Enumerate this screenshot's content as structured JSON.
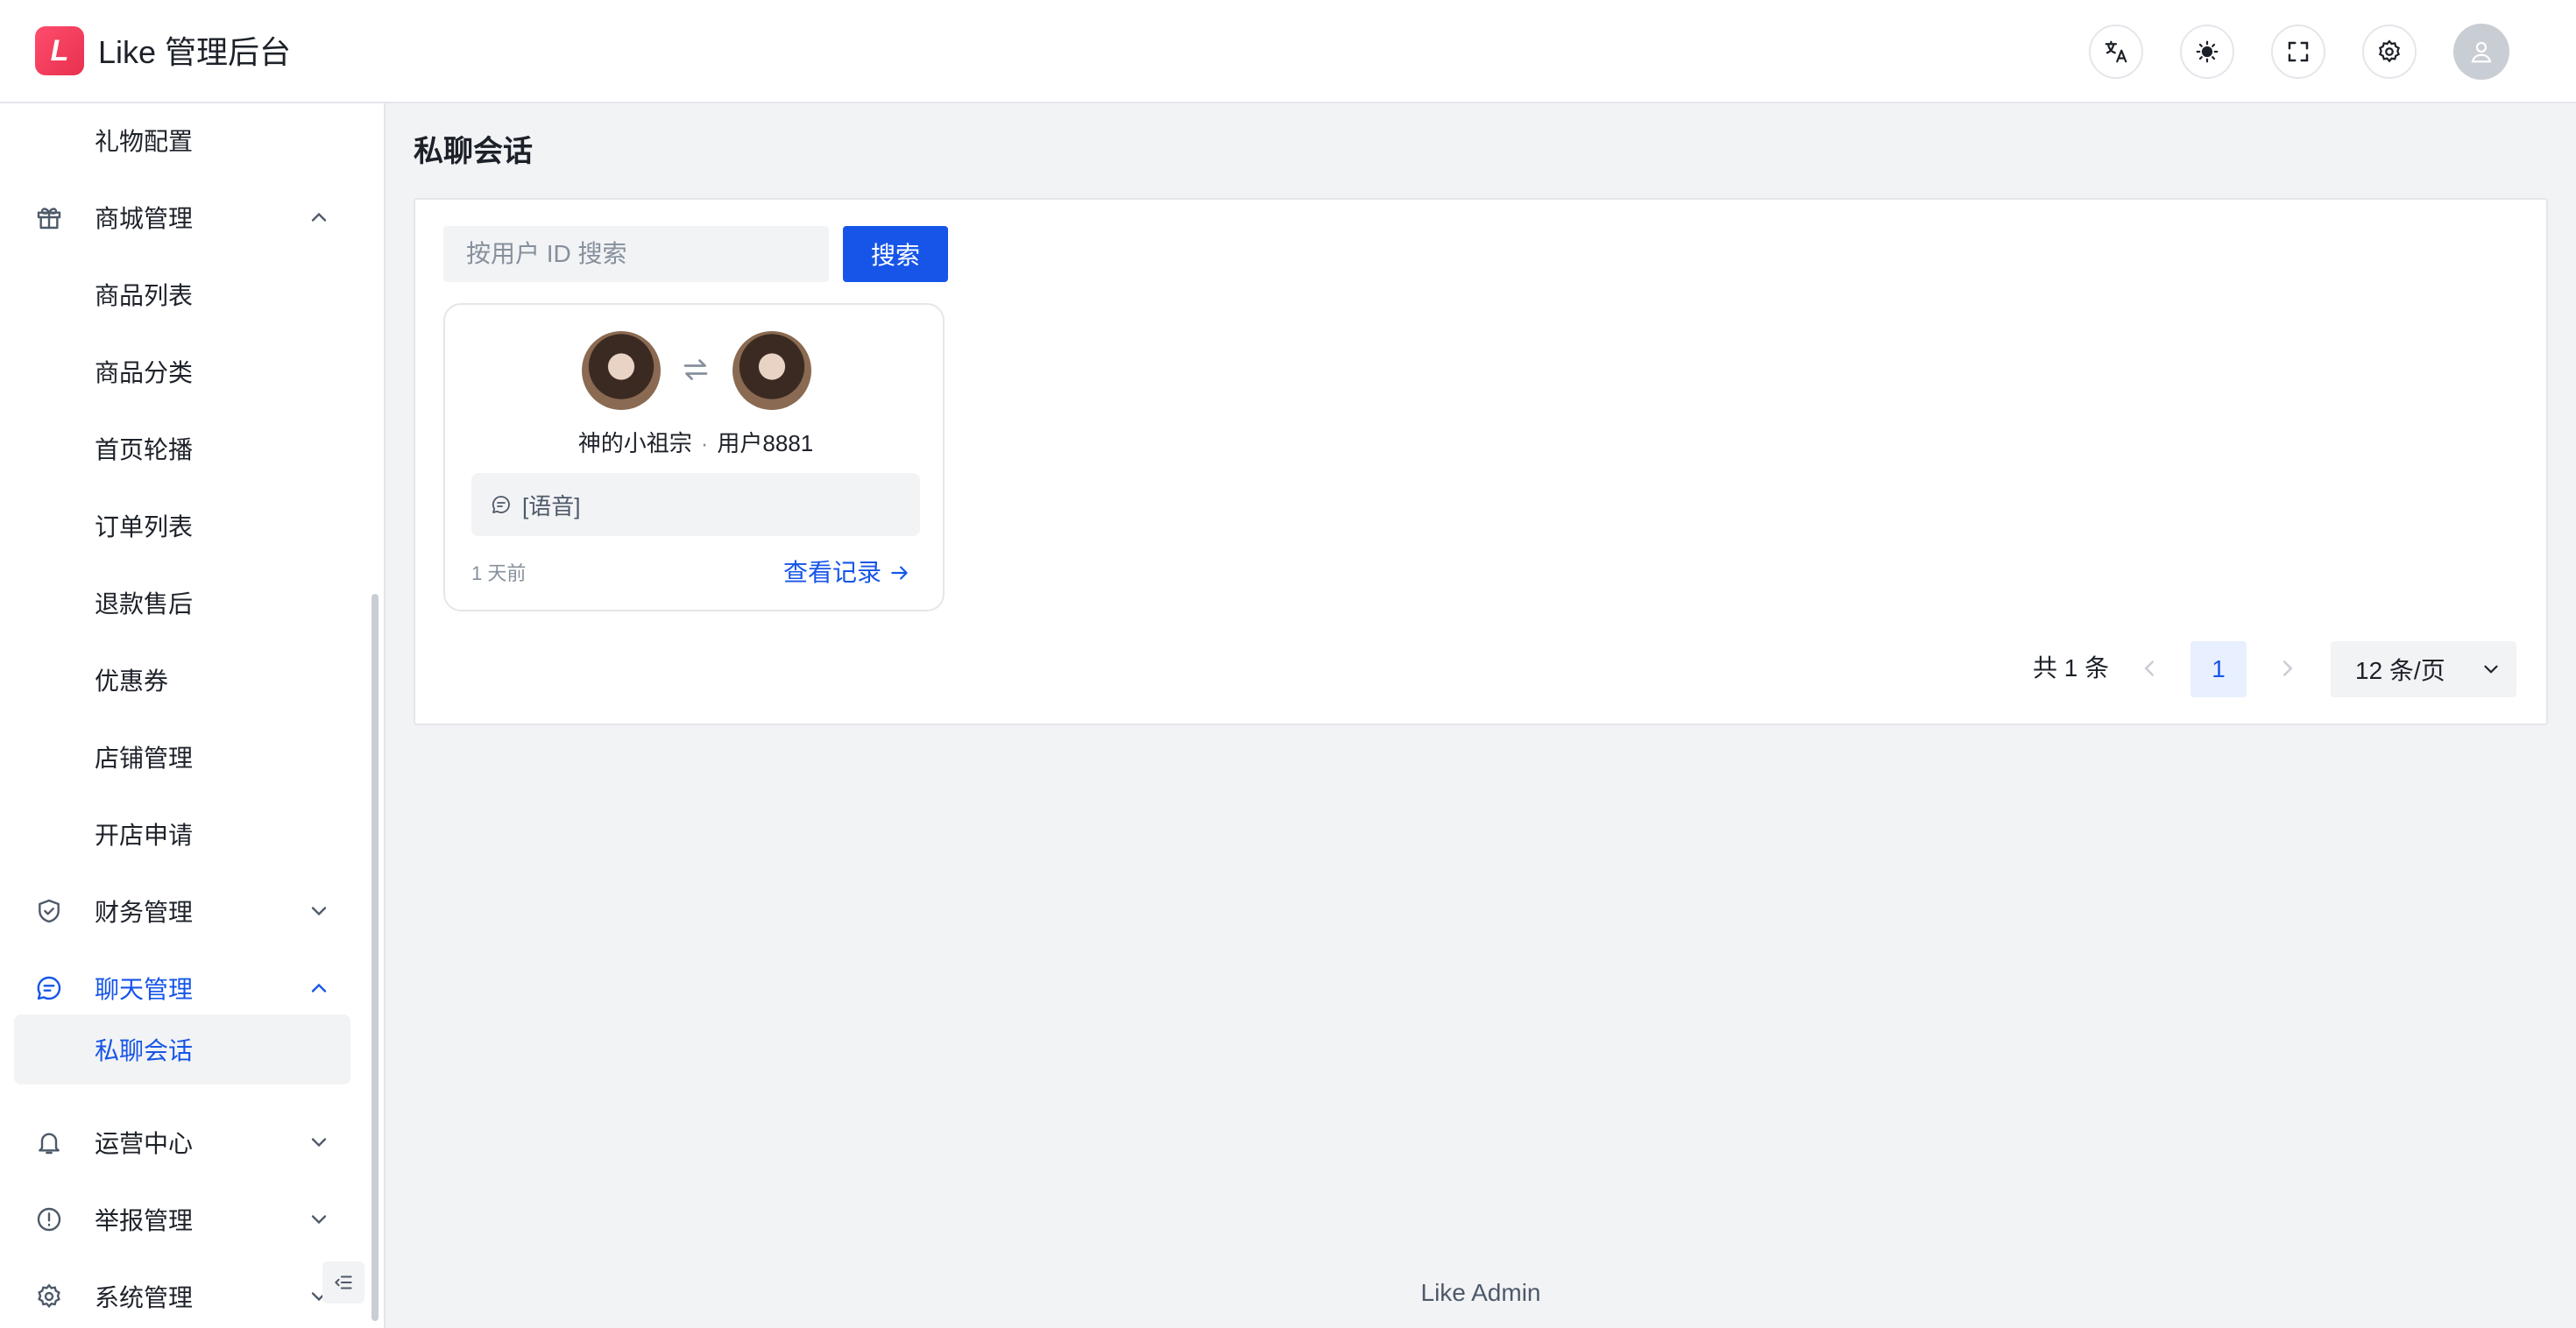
{
  "header": {
    "logo_letter": "L",
    "title": "Like 管理后台",
    "actions": [
      "translate-icon",
      "theme-icon",
      "fullscreen-icon",
      "settings-icon",
      "user-icon"
    ]
  },
  "sidebar": {
    "items": [
      {
        "label": "礼物配置",
        "type": "child"
      },
      {
        "label": "商城管理",
        "type": "group",
        "icon": "gift-box-icon",
        "expanded": true
      },
      {
        "label": "商品列表",
        "type": "child"
      },
      {
        "label": "商品分类",
        "type": "child"
      },
      {
        "label": "首页轮播",
        "type": "child"
      },
      {
        "label": "订单列表",
        "type": "child"
      },
      {
        "label": "退款售后",
        "type": "child"
      },
      {
        "label": "优惠券",
        "type": "child"
      },
      {
        "label": "店铺管理",
        "type": "child"
      },
      {
        "label": "开店申请",
        "type": "child"
      },
      {
        "label": "财务管理",
        "type": "group",
        "icon": "shield-icon",
        "expanded": false
      },
      {
        "label": "聊天管理",
        "type": "group",
        "icon": "chat-icon",
        "expanded": true,
        "active": true
      },
      {
        "label": "私聊会话",
        "type": "child",
        "selected": true
      },
      {
        "label": "运营中心",
        "type": "group",
        "icon": "bell-icon",
        "expanded": false
      },
      {
        "label": "举报管理",
        "type": "group",
        "icon": "alert-icon",
        "expanded": false
      },
      {
        "label": "系统管理",
        "type": "group",
        "icon": "gear-icon",
        "expanded": false
      }
    ]
  },
  "main": {
    "page_title": "私聊会话",
    "search": {
      "placeholder": "按用户 ID 搜索",
      "value": "",
      "button_label": "搜索"
    },
    "cards": [
      {
        "user_a": "神的小祖宗",
        "separator": "·",
        "user_b": "用户8881",
        "last_message": "[语音]",
        "time": "1 天前",
        "link_label": "查看记录"
      }
    ],
    "pagination": {
      "total_text": "共 1 条",
      "current_page": "1",
      "page_size": "12 条/页"
    }
  },
  "footer": {
    "text": "Like Admin"
  },
  "colors": {
    "accent": "#1655e8",
    "brand": "#e8304f",
    "background": "#f2f3f5"
  }
}
